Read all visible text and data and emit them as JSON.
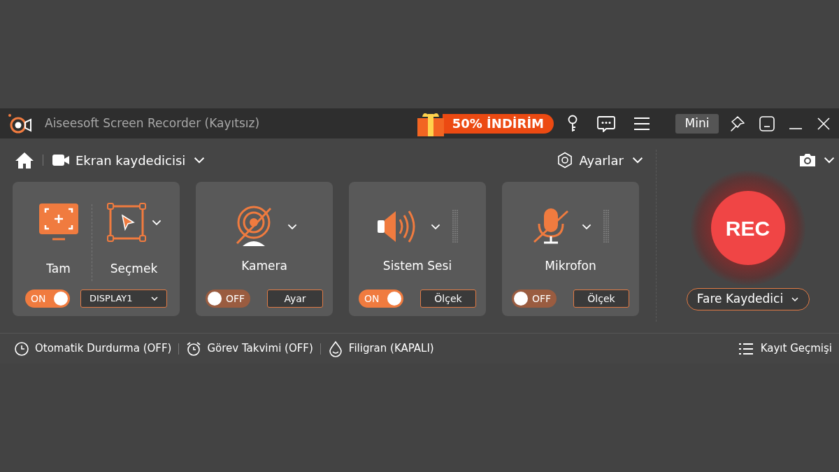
{
  "window": {
    "title": "Aiseesoft Screen Recorder (Kayıtsız)",
    "promo": "50% İNDİRİM",
    "mini_button": "Mini"
  },
  "nav": {
    "mode": "Ekran kaydedicisi",
    "settings": "Ayarlar"
  },
  "cards": [
    {
      "kind": "display",
      "sources": [
        "Tam",
        "Seçmek"
      ],
      "on": true,
      "toggle_label": "ON",
      "select": "DISPLAY1"
    },
    {
      "kind": "camera",
      "label": "Kamera",
      "on": false,
      "toggle_label": "OFF",
      "button": "Ayar"
    },
    {
      "kind": "speaker",
      "label": "Sistem Sesi",
      "on": true,
      "toggle_label": "ON",
      "button": "Ölçek"
    },
    {
      "kind": "microphone",
      "label": "Mikrofon",
      "on": false,
      "toggle_label": "OFF",
      "button": "Ölçek"
    }
  ],
  "record": {
    "button": "REC",
    "mode": "Fare Kaydedici"
  },
  "footer": {
    "items": [
      {
        "kind": "timer",
        "label": "Otomatik Durdurma (OFF)"
      },
      {
        "kind": "alarm",
        "label": "Görev Takvimi (OFF)"
      },
      {
        "kind": "watermark",
        "label": "Filigran (KAPALI)"
      }
    ],
    "history": "Kayıt Geçmişi"
  }
}
